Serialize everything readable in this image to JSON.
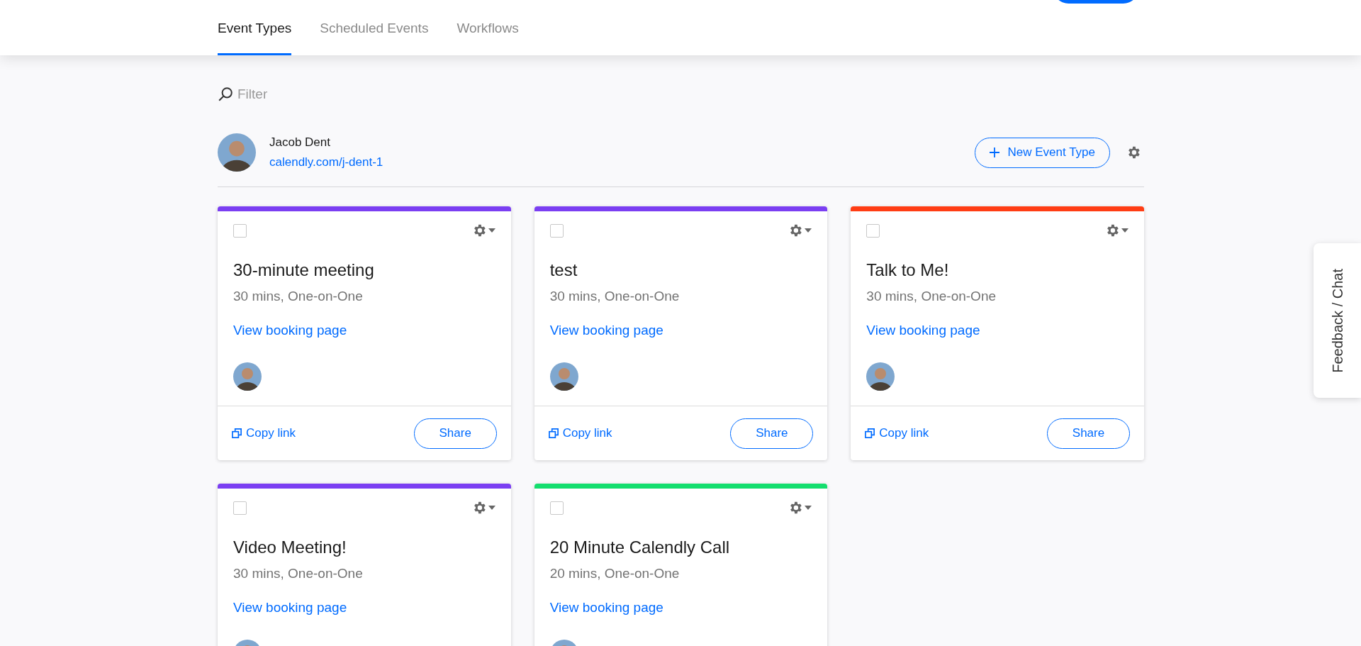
{
  "tabs": [
    {
      "label": "Event Types",
      "selected": true
    },
    {
      "label": "Scheduled Events",
      "selected": false
    },
    {
      "label": "Workflows",
      "selected": false
    }
  ],
  "filter": {
    "placeholder": "Filter"
  },
  "user": {
    "name": "Jacob Dent",
    "link": "calendly.com/j-dent-1"
  },
  "new_event_button": {
    "label": "New Event Type"
  },
  "event_types": [
    {
      "title": "30-minute meeting",
      "details": "30 mins, One-on-One",
      "link_label": "View booking page",
      "color": "#7b3ff2",
      "checked": false,
      "copy_label": "Copy link",
      "share_label": "Share"
    },
    {
      "title": "test",
      "details": "30 mins, One-on-One",
      "link_label": "View booking page",
      "color": "#7b3ff2",
      "checked": false,
      "copy_label": "Copy link",
      "share_label": "Share"
    },
    {
      "title": "Talk to Me!",
      "details": "30 mins, One-on-One",
      "link_label": "View booking page",
      "color": "#ff3d14",
      "checked": false,
      "copy_label": "Copy link",
      "share_label": "Share"
    },
    {
      "title": "Video Meeting!",
      "details": "30 mins, One-on-One",
      "link_label": "View booking page",
      "color": "#7b3ff2",
      "checked": false
    },
    {
      "title": "20 Minute Calendly Call",
      "details": "20 mins, One-on-One",
      "link_label": "View booking page",
      "color": "#14de6e",
      "checked": false
    }
  ],
  "feedback_tab": {
    "label": "Feedback / Chat"
  }
}
